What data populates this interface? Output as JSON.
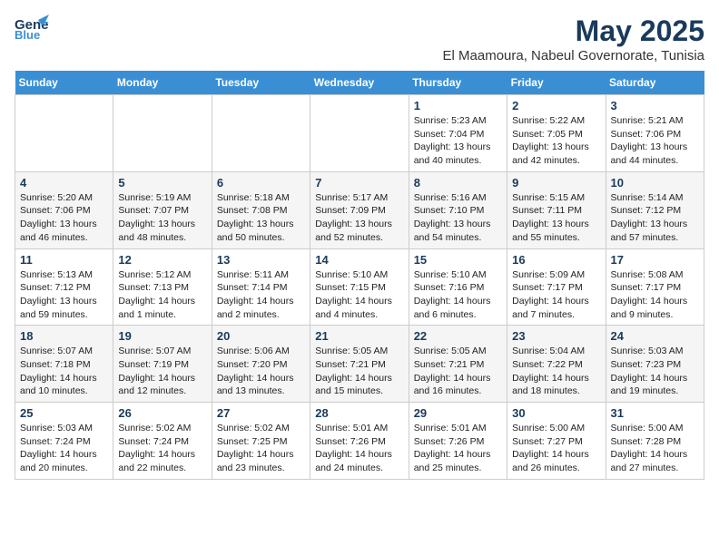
{
  "logo": {
    "line1": "General",
    "line2": "Blue"
  },
  "title": "May 2025",
  "subtitle": "El Maamoura, Nabeul Governorate, Tunisia",
  "days_of_week": [
    "Sunday",
    "Monday",
    "Tuesday",
    "Wednesday",
    "Thursday",
    "Friday",
    "Saturday"
  ],
  "weeks": [
    [
      {
        "num": "",
        "info": ""
      },
      {
        "num": "",
        "info": ""
      },
      {
        "num": "",
        "info": ""
      },
      {
        "num": "",
        "info": ""
      },
      {
        "num": "1",
        "info": "Sunrise: 5:23 AM\nSunset: 7:04 PM\nDaylight: 13 hours\nand 40 minutes."
      },
      {
        "num": "2",
        "info": "Sunrise: 5:22 AM\nSunset: 7:05 PM\nDaylight: 13 hours\nand 42 minutes."
      },
      {
        "num": "3",
        "info": "Sunrise: 5:21 AM\nSunset: 7:06 PM\nDaylight: 13 hours\nand 44 minutes."
      }
    ],
    [
      {
        "num": "4",
        "info": "Sunrise: 5:20 AM\nSunset: 7:06 PM\nDaylight: 13 hours\nand 46 minutes."
      },
      {
        "num": "5",
        "info": "Sunrise: 5:19 AM\nSunset: 7:07 PM\nDaylight: 13 hours\nand 48 minutes."
      },
      {
        "num": "6",
        "info": "Sunrise: 5:18 AM\nSunset: 7:08 PM\nDaylight: 13 hours\nand 50 minutes."
      },
      {
        "num": "7",
        "info": "Sunrise: 5:17 AM\nSunset: 7:09 PM\nDaylight: 13 hours\nand 52 minutes."
      },
      {
        "num": "8",
        "info": "Sunrise: 5:16 AM\nSunset: 7:10 PM\nDaylight: 13 hours\nand 54 minutes."
      },
      {
        "num": "9",
        "info": "Sunrise: 5:15 AM\nSunset: 7:11 PM\nDaylight: 13 hours\nand 55 minutes."
      },
      {
        "num": "10",
        "info": "Sunrise: 5:14 AM\nSunset: 7:12 PM\nDaylight: 13 hours\nand 57 minutes."
      }
    ],
    [
      {
        "num": "11",
        "info": "Sunrise: 5:13 AM\nSunset: 7:12 PM\nDaylight: 13 hours\nand 59 minutes."
      },
      {
        "num": "12",
        "info": "Sunrise: 5:12 AM\nSunset: 7:13 PM\nDaylight: 14 hours\nand 1 minute."
      },
      {
        "num": "13",
        "info": "Sunrise: 5:11 AM\nSunset: 7:14 PM\nDaylight: 14 hours\nand 2 minutes."
      },
      {
        "num": "14",
        "info": "Sunrise: 5:10 AM\nSunset: 7:15 PM\nDaylight: 14 hours\nand 4 minutes."
      },
      {
        "num": "15",
        "info": "Sunrise: 5:10 AM\nSunset: 7:16 PM\nDaylight: 14 hours\nand 6 minutes."
      },
      {
        "num": "16",
        "info": "Sunrise: 5:09 AM\nSunset: 7:17 PM\nDaylight: 14 hours\nand 7 minutes."
      },
      {
        "num": "17",
        "info": "Sunrise: 5:08 AM\nSunset: 7:17 PM\nDaylight: 14 hours\nand 9 minutes."
      }
    ],
    [
      {
        "num": "18",
        "info": "Sunrise: 5:07 AM\nSunset: 7:18 PM\nDaylight: 14 hours\nand 10 minutes."
      },
      {
        "num": "19",
        "info": "Sunrise: 5:07 AM\nSunset: 7:19 PM\nDaylight: 14 hours\nand 12 minutes."
      },
      {
        "num": "20",
        "info": "Sunrise: 5:06 AM\nSunset: 7:20 PM\nDaylight: 14 hours\nand 13 minutes."
      },
      {
        "num": "21",
        "info": "Sunrise: 5:05 AM\nSunset: 7:21 PM\nDaylight: 14 hours\nand 15 minutes."
      },
      {
        "num": "22",
        "info": "Sunrise: 5:05 AM\nSunset: 7:21 PM\nDaylight: 14 hours\nand 16 minutes."
      },
      {
        "num": "23",
        "info": "Sunrise: 5:04 AM\nSunset: 7:22 PM\nDaylight: 14 hours\nand 18 minutes."
      },
      {
        "num": "24",
        "info": "Sunrise: 5:03 AM\nSunset: 7:23 PM\nDaylight: 14 hours\nand 19 minutes."
      }
    ],
    [
      {
        "num": "25",
        "info": "Sunrise: 5:03 AM\nSunset: 7:24 PM\nDaylight: 14 hours\nand 20 minutes."
      },
      {
        "num": "26",
        "info": "Sunrise: 5:02 AM\nSunset: 7:24 PM\nDaylight: 14 hours\nand 22 minutes."
      },
      {
        "num": "27",
        "info": "Sunrise: 5:02 AM\nSunset: 7:25 PM\nDaylight: 14 hours\nand 23 minutes."
      },
      {
        "num": "28",
        "info": "Sunrise: 5:01 AM\nSunset: 7:26 PM\nDaylight: 14 hours\nand 24 minutes."
      },
      {
        "num": "29",
        "info": "Sunrise: 5:01 AM\nSunset: 7:26 PM\nDaylight: 14 hours\nand 25 minutes."
      },
      {
        "num": "30",
        "info": "Sunrise: 5:00 AM\nSunset: 7:27 PM\nDaylight: 14 hours\nand 26 minutes."
      },
      {
        "num": "31",
        "info": "Sunrise: 5:00 AM\nSunset: 7:28 PM\nDaylight: 14 hours\nand 27 minutes."
      }
    ]
  ]
}
